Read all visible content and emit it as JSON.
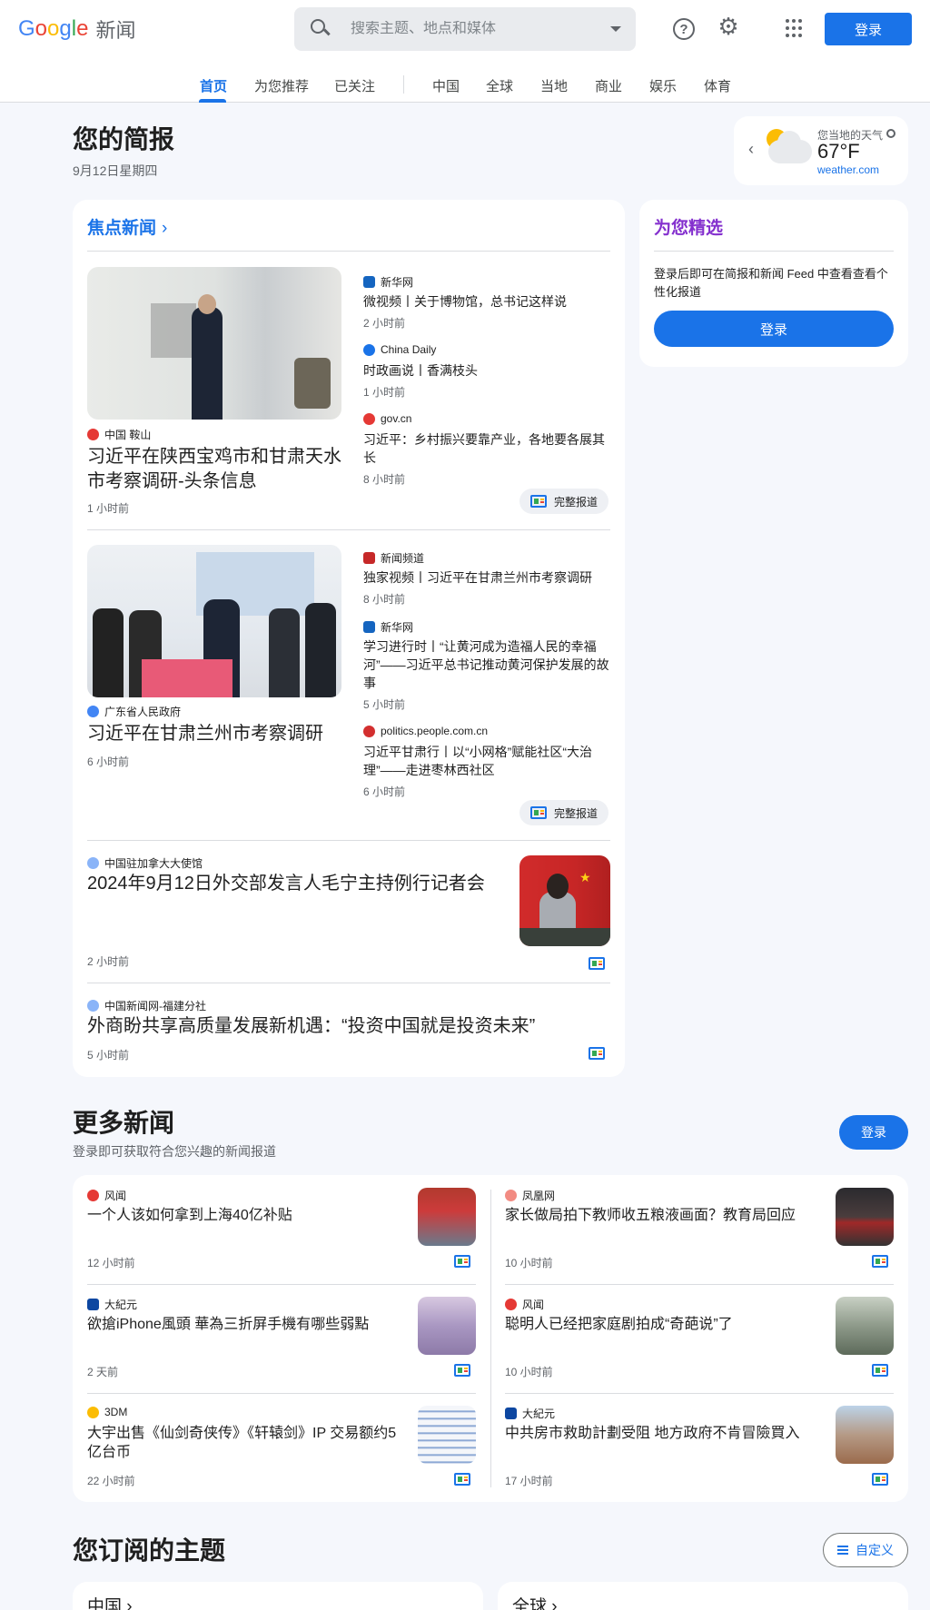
{
  "header": {
    "logo_text": "Google",
    "product": "新闻",
    "search_placeholder": "搜索主题、地点和媒体",
    "login": "登录"
  },
  "nav": {
    "tabs": [
      "首页",
      "为您推荐",
      "已关注",
      "中国",
      "全球",
      "当地",
      "商业",
      "娱乐",
      "体育"
    ],
    "active": "首页"
  },
  "briefing": {
    "title": "您的简报",
    "date": "9月12日星期四"
  },
  "weather": {
    "label": "您当地的天气",
    "temp": "67°F",
    "site": "weather.com"
  },
  "headlines": {
    "title": "焦点新闻",
    "full_coverage": "完整报道",
    "story1": {
      "source": "中国 鞍山",
      "title": "习近平在陕西宝鸡市和甘肃天水市考察调研-头条信息",
      "time": "1 小时前",
      "related": [
        {
          "source": "新华网",
          "title": "微视频丨关于博物馆，总书记这样说",
          "time": "2 小时前"
        },
        {
          "source": "China Daily",
          "title": "时政画说丨香满枝头",
          "time": "1 小时前"
        },
        {
          "source": "gov.cn",
          "title": "习近平：乡村振兴要靠产业，各地要各展其长",
          "time": "8 小时前"
        }
      ]
    },
    "story2": {
      "source": "广东省人民政府",
      "title": "习近平在甘肃兰州市考察调研",
      "time": "6 小时前",
      "related": [
        {
          "source": "新闻频道",
          "title": "独家视频丨习近平在甘肃兰州市考察调研",
          "time": "8 小时前"
        },
        {
          "source": "新华网",
          "title": "学习进行时丨“让黄河成为造福人民的幸福河”——习近平总书记推动黄河保护发展的故事",
          "time": "5 小时前"
        },
        {
          "source": "politics.people.com.cn",
          "title": "习近平甘肃行丨以“小网格”赋能社区“大治理”——走进枣林西社区",
          "time": "6 小时前"
        }
      ]
    },
    "story3": {
      "source": "中国驻加拿大大使馆",
      "title": "2024年9月12日外交部发言人毛宁主持例行记者会",
      "time": "2 小时前"
    },
    "story4": {
      "source": "中国新闻网-福建分社",
      "title": "外商盼共享高质量发展新机遇：“投资中国就是投资未来”",
      "time": "5 小时前"
    }
  },
  "for_you": {
    "title": "为您精选",
    "desc": "登录后即可在简报和新闻 Feed 中查看查看个性化报道",
    "login": "登录"
  },
  "more_news": {
    "title": "更多新闻",
    "subtitle": "登录即可获取符合您兴趣的新闻报道",
    "login": "登录",
    "items": [
      {
        "source": "风闻",
        "title": "一个人该如何拿到上海40亿补贴",
        "time": "12 小时前"
      },
      {
        "source": "凤凰网",
        "title": "家长做局拍下教师收五粮液画面？教育局回应",
        "time": "10 小时前"
      },
      {
        "source": "大紀元",
        "title": "欲搶iPhone風頭 華為三折屏手機有哪些弱點",
        "time": "2 天前"
      },
      {
        "source": "风闻",
        "title": "聪明人已经把家庭剧拍成“奇葩说”了",
        "time": "10 小时前"
      },
      {
        "source": "3DM",
        "title": "大宇出售《仙剑奇侠传》《轩辕剑》IP 交易额约5亿台币",
        "time": "22 小时前"
      },
      {
        "source": "大紀元",
        "title": "中共房市救助計劃受阻 地方政府不肯冒險買入",
        "time": "17 小时前"
      }
    ]
  },
  "topics": {
    "title": "您订阅的主题",
    "customize": "自定义",
    "cards": [
      "中国 ›",
      "全球 ›"
    ]
  },
  "colors": {
    "accent": "#1a73e8",
    "background": "#f5f7fc",
    "for_you_title": "#8430ce"
  }
}
